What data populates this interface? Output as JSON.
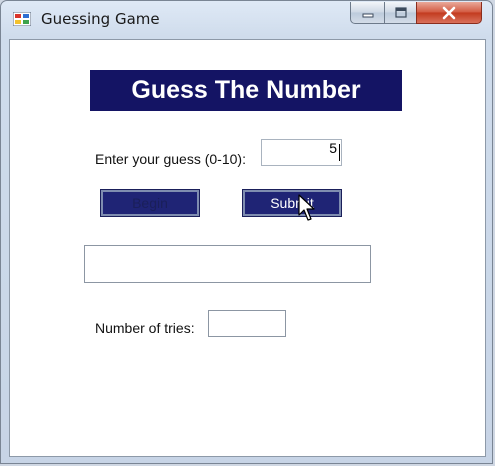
{
  "window": {
    "title": "Guessing Game",
    "controls": {
      "minimize": "minimize",
      "maximize": "maximize",
      "close": "close"
    }
  },
  "form": {
    "heading": "Guess The Number",
    "guess_label": "Enter your guess (0-10):",
    "guess_value": "5",
    "begin_label": "Begin",
    "submit_label": "Submit",
    "result_text": "",
    "tries_label": "Number of tries:",
    "tries_value": ""
  },
  "colors": {
    "heading_bg": "#141464",
    "button_bg": "#1f2475",
    "close_button": "#c23a1e"
  },
  "icons": [
    "app-icon",
    "minimize-icon",
    "maximize-icon",
    "close-icon",
    "mouse-cursor-icon"
  ]
}
